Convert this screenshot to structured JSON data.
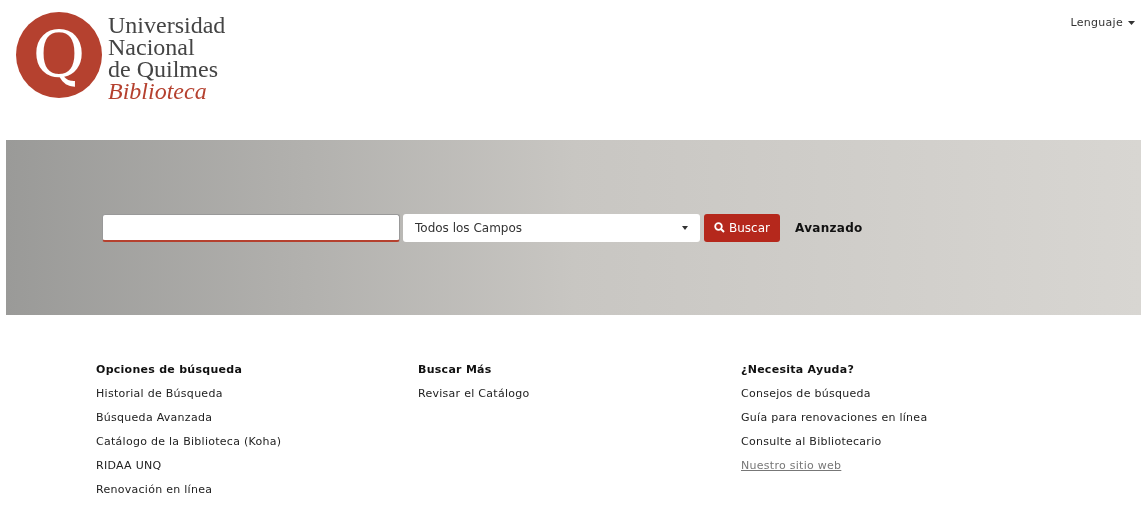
{
  "header": {
    "logo": {
      "letter": "Q",
      "lines": [
        "Universidad",
        "Nacional",
        "de Quilmes"
      ],
      "subtitle": "Biblioteca"
    },
    "language_menu": {
      "label": "Lenguaje"
    }
  },
  "search": {
    "field_select": "Todos los Campos",
    "button": "Buscar",
    "advanced_link": "Avanzado"
  },
  "footer_columns": [
    {
      "heading": "Opciones de búsqueda",
      "links": [
        {
          "label": "Historial de Búsqueda",
          "kind": "plain"
        },
        {
          "label": "Búsqueda Avanzada",
          "kind": "plain"
        },
        {
          "label": "Catálogo de la Biblioteca (Koha)",
          "kind": "plain"
        },
        {
          "label": "RIDAA UNQ",
          "kind": "plain"
        },
        {
          "label": "Renovación en línea",
          "kind": "plain"
        }
      ]
    },
    {
      "heading": "Buscar Más",
      "links": [
        {
          "label": "Revisar el Catálogo",
          "kind": "plain"
        }
      ]
    },
    {
      "heading": "¿Necesita Ayuda?",
      "links": [
        {
          "label": "Consejos de búsqueda",
          "kind": "plain"
        },
        {
          "label": "Guía para renovaciones en línea",
          "kind": "plain"
        },
        {
          "label": "Consulte al Bibliotecario",
          "kind": "plain"
        },
        {
          "label": "Nuestro sitio web",
          "kind": "underlined"
        }
      ]
    }
  ]
}
